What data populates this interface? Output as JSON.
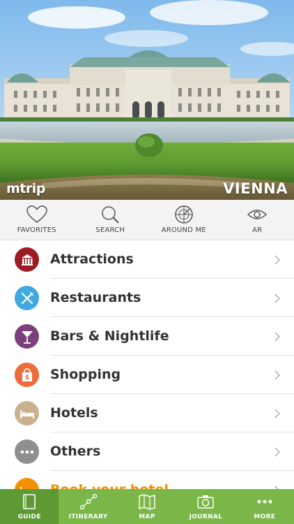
{
  "hero": {
    "brand": "mtrip",
    "city": "VIENNA"
  },
  "quickbar": {
    "items": [
      {
        "label": "FAVORITES",
        "icon": "heart-icon"
      },
      {
        "label": "SEARCH",
        "icon": "magnifier-icon"
      },
      {
        "label": "AROUND ME",
        "icon": "radar-icon"
      },
      {
        "label": "AR",
        "icon": "eye-icon"
      }
    ]
  },
  "categories": [
    {
      "label": "Attractions",
      "icon": "museum-icon",
      "color": "#9b1c22"
    },
    {
      "label": "Restaurants",
      "icon": "fork-knife-icon",
      "color": "#3fa9e0"
    },
    {
      "label": "Bars & Nightlife",
      "icon": "cocktail-icon",
      "color": "#7b3f7c"
    },
    {
      "label": "Shopping",
      "icon": "shopping-bag-icon",
      "color": "#ee6b3b"
    },
    {
      "label": "Hotels",
      "icon": "bed-icon",
      "color": "#c9b08e"
    },
    {
      "label": "Others",
      "icon": "more-dots-icon",
      "color": "#8f8f8f"
    },
    {
      "label": "Book your hotel",
      "icon": "hotel-booking-icon",
      "color": "#f39200"
    }
  ],
  "tabbar": {
    "items": [
      {
        "label": "GUIDE",
        "icon": "book-icon",
        "active": true
      },
      {
        "label": "ITINERARY",
        "icon": "route-icon",
        "active": false
      },
      {
        "label": "MAP",
        "icon": "map-icon",
        "active": false
      },
      {
        "label": "JOURNAL",
        "icon": "camera-icon",
        "active": false
      },
      {
        "label": "MORE",
        "icon": "ellipsis-icon",
        "active": false
      }
    ]
  },
  "colors": {
    "tab_green": "#7ab648",
    "tab_active": "#5e9a33",
    "book_accent": "#f39200"
  }
}
